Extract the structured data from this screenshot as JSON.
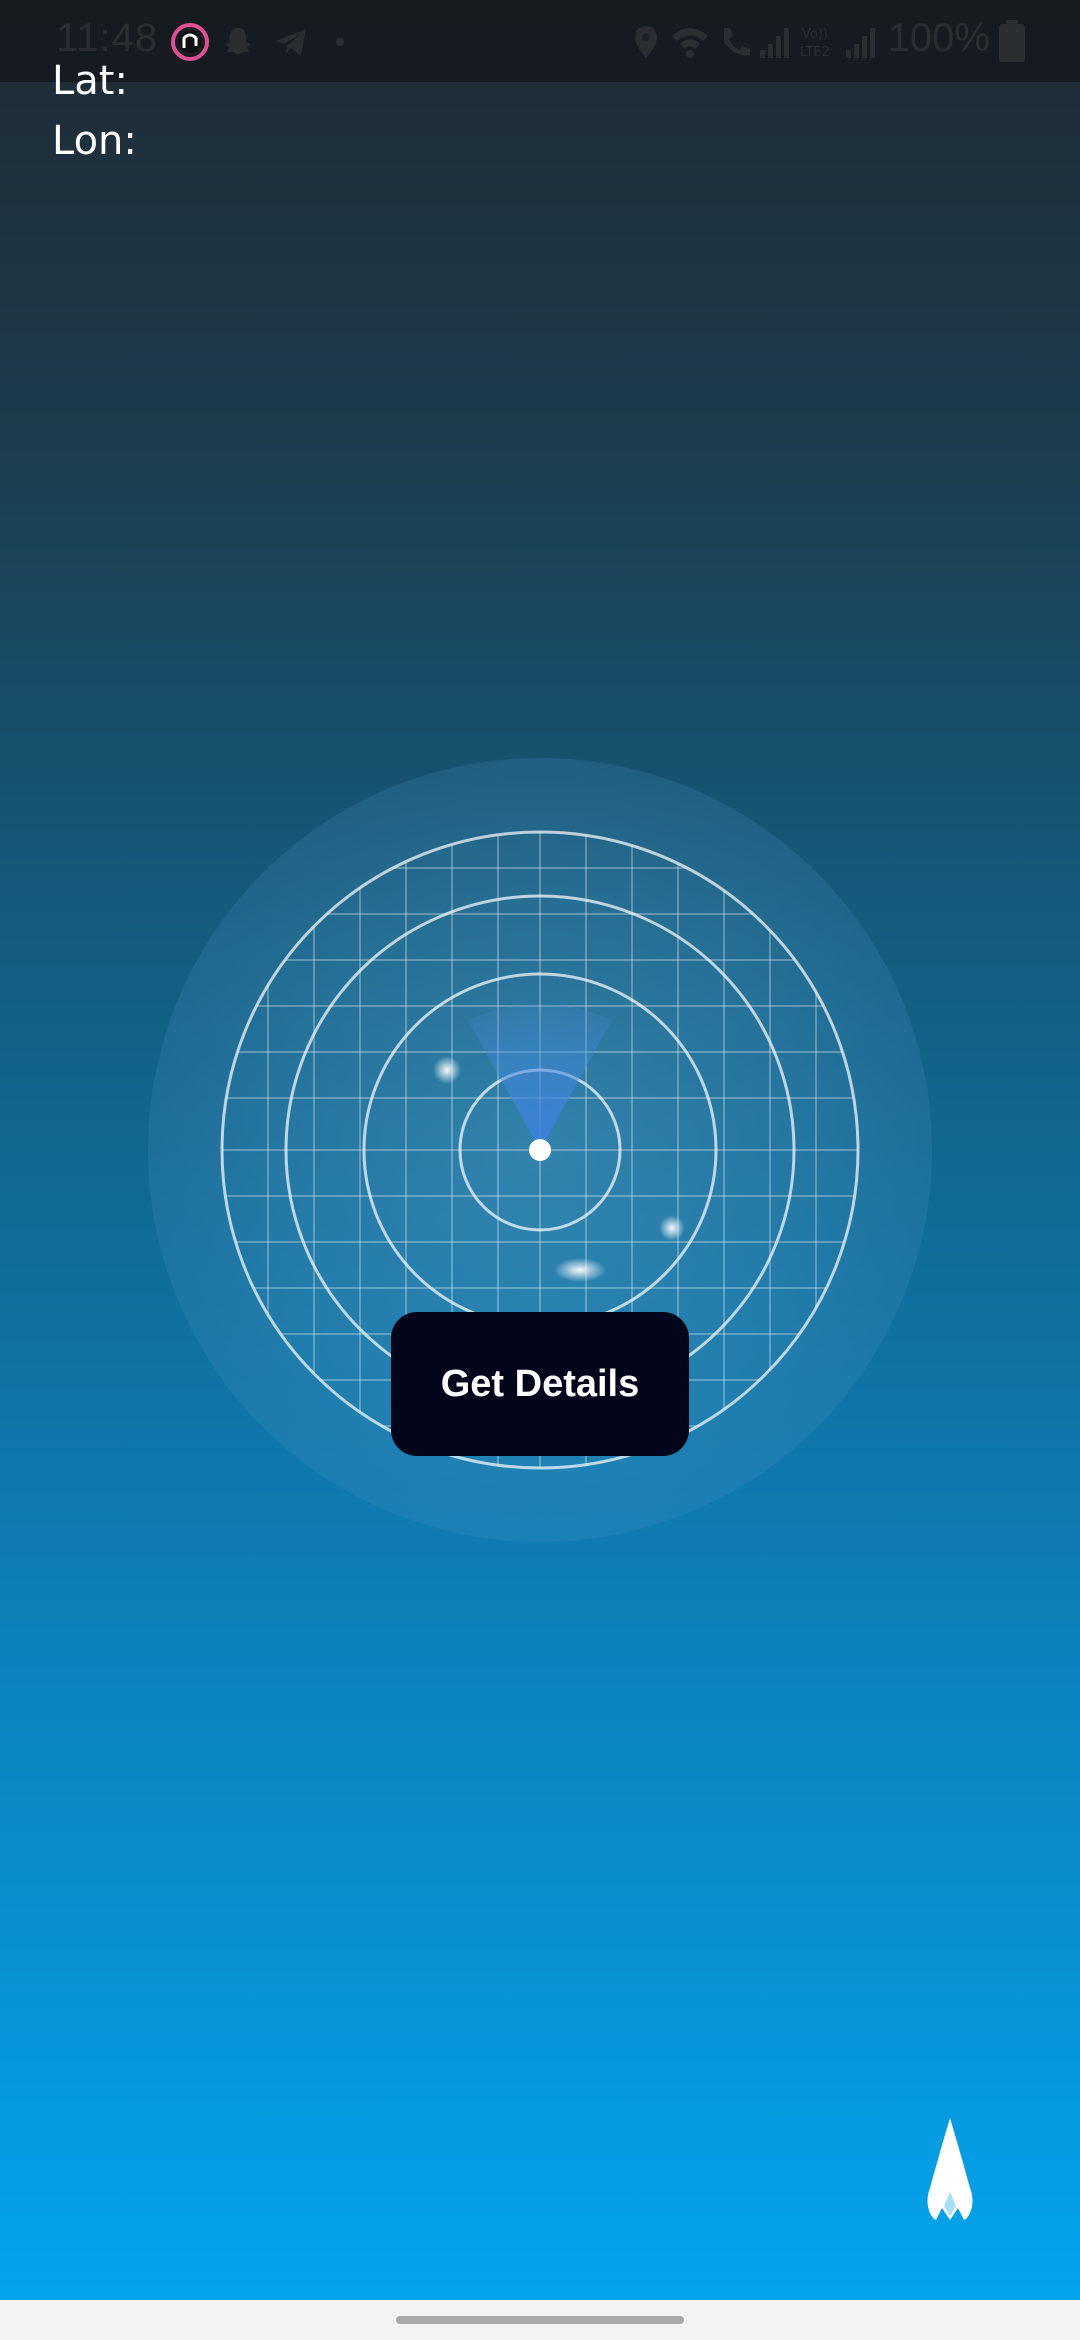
{
  "status_bar": {
    "time": "11:48",
    "battery": "100%",
    "icons": [
      "app-circle-icon",
      "snapchat-icon",
      "telegram-icon",
      "dot-icon",
      "location-icon",
      "wifi-icon",
      "wifi-call-icon",
      "signal-icon",
      "volte-icon",
      "signal-2-icon",
      "battery-icon"
    ]
  },
  "coords": {
    "lat_label": "Lat:",
    "lon_label": "Lon:"
  },
  "action": {
    "button_label": "Get Details"
  },
  "fab": {
    "icon": "rocket-icon"
  },
  "colors": {
    "button_bg": "#03051a",
    "gradient_top": "#1f2a33",
    "gradient_bottom": "#03a4ee",
    "radar_beam": "#4a8fdc"
  }
}
